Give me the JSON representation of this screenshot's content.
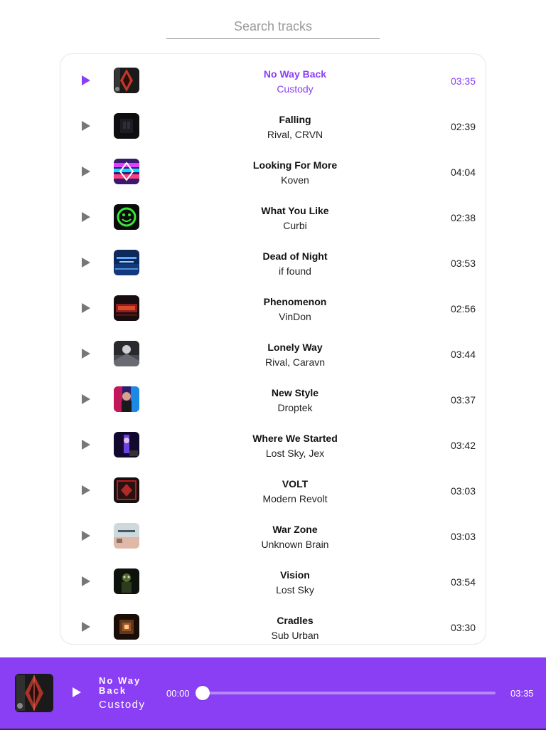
{
  "search": {
    "placeholder": "Search tracks",
    "value": ""
  },
  "colors": {
    "accent": "#8a3ff5",
    "player_bg": "#8a3ff5"
  },
  "tracks": [
    {
      "title": "No Way Back",
      "artist": "Custody",
      "duration": "03:35",
      "active": true,
      "cover": "cover-no-way-back"
    },
    {
      "title": "Falling",
      "artist": "Rival, CRVN",
      "duration": "02:39",
      "active": false,
      "cover": "cover-falling"
    },
    {
      "title": "Looking For More",
      "artist": "Koven",
      "duration": "04:04",
      "active": false,
      "cover": "cover-looking-for-more"
    },
    {
      "title": "What You Like",
      "artist": "Curbi",
      "duration": "02:38",
      "active": false,
      "cover": "cover-what-you-like"
    },
    {
      "title": "Dead of Night",
      "artist": "if found",
      "duration": "03:53",
      "active": false,
      "cover": "cover-dead-of-night"
    },
    {
      "title": "Phenomenon",
      "artist": "VinDon",
      "duration": "02:56",
      "active": false,
      "cover": "cover-phenomenon"
    },
    {
      "title": "Lonely Way",
      "artist": "Rival, Caravn",
      "duration": "03:44",
      "active": false,
      "cover": "cover-lonely-way"
    },
    {
      "title": "New Style",
      "artist": "Droptek",
      "duration": "03:37",
      "active": false,
      "cover": "cover-new-style"
    },
    {
      "title": "Where We Started",
      "artist": "Lost Sky, Jex",
      "duration": "03:42",
      "active": false,
      "cover": "cover-where-we-started"
    },
    {
      "title": "VOLT",
      "artist": "Modern Revolt",
      "duration": "03:03",
      "active": false,
      "cover": "cover-volt"
    },
    {
      "title": "War Zone",
      "artist": "Unknown Brain",
      "duration": "03:03",
      "active": false,
      "cover": "cover-war-zone"
    },
    {
      "title": "Vision",
      "artist": "Lost Sky",
      "duration": "03:54",
      "active": false,
      "cover": "cover-vision"
    },
    {
      "title": "Cradles",
      "artist": "Sub Urban",
      "duration": "03:30",
      "active": false,
      "cover": "cover-cradles"
    }
  ],
  "player": {
    "title": "No Way Back",
    "artist": "Custody",
    "current_time": "00:00",
    "total_time": "03:35",
    "progress": 0
  }
}
